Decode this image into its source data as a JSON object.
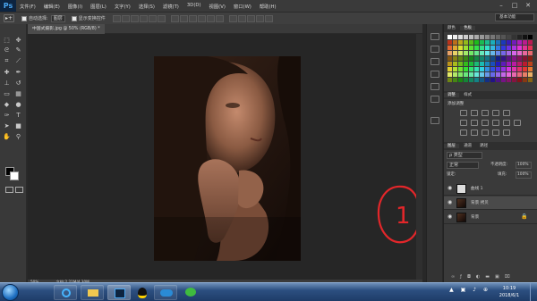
{
  "app": {
    "logo": "Ps"
  },
  "menubar": {
    "items": [
      "文件(F)",
      "编辑(E)",
      "图像(I)",
      "图层(L)",
      "文字(Y)",
      "选择(S)",
      "滤镜(T)",
      "3D(D)",
      "视图(V)",
      "窗口(W)",
      "帮助(H)"
    ]
  },
  "window_controls": {
    "minimize": "–",
    "maximize": "□",
    "close": "✕"
  },
  "options": {
    "move_icon": "▸+",
    "auto_select_label": "自动选择:",
    "auto_select_value": "图层",
    "show_transform_label": "显示变换控件"
  },
  "workspace": {
    "label": "基本功能"
  },
  "document": {
    "tab": "中国式摄影.jpg @ 50% (RGB/8) *",
    "zoom": "50%",
    "file_info": "文档:2.21M/4.30M"
  },
  "panels": {
    "swatch_tabs": [
      "颜色",
      "色板"
    ],
    "adjust_tabs": [
      "调整",
      "样式"
    ],
    "adjust_title": "添加调整",
    "layer_tabs": [
      "图层",
      "通道",
      "路径"
    ],
    "layer_filter": "ρ 类型",
    "blend_mode": "正常",
    "opacity_label": "不透明度:",
    "opacity_value": "100%",
    "lock_label": "锁定:",
    "fill_label": "填充:",
    "fill_value": "100%",
    "layers": [
      {
        "name": "曲线 1",
        "visible": true
      },
      {
        "name": "背景 拷贝",
        "visible": true
      },
      {
        "name": "背景",
        "visible": true
      }
    ]
  },
  "annotation": {
    "text": "1",
    "color": "#e3262a"
  },
  "taskbar": {
    "time": "10:19",
    "date": "2018/6/1",
    "tray": "▲ ▣ ♪ ⊕"
  },
  "colors": {
    "chrome": "#3a3a3a",
    "canvas": "#262626",
    "accent": "#4aa7f2",
    "annotation": "#e3262a"
  }
}
